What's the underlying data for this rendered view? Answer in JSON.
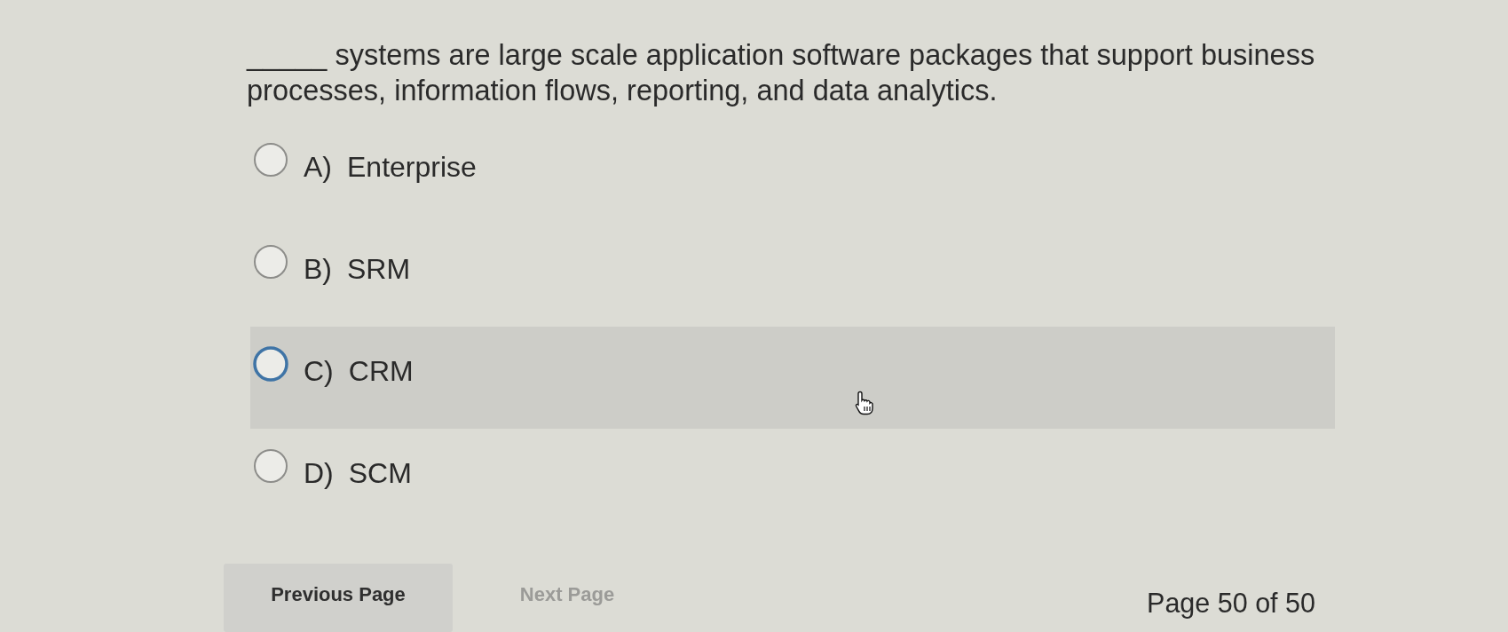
{
  "question": {
    "text": "_____ systems are large scale application software packages that support business processes, information flows, reporting, and data analytics."
  },
  "options": [
    {
      "letter": "A)",
      "text": "Enterprise",
      "selected": false,
      "hovered": false
    },
    {
      "letter": "B)",
      "text": "SRM",
      "selected": false,
      "hovered": false
    },
    {
      "letter": "C)",
      "text": "CRM",
      "selected": false,
      "hovered": true
    },
    {
      "letter": "D)",
      "text": "SCM",
      "selected": false,
      "hovered": false
    }
  ],
  "navigation": {
    "buttons": [
      {
        "label": "Previous Page",
        "disabled": false
      },
      {
        "label": "Next Page",
        "disabled": true
      }
    ],
    "page_indicator": "Page 50 of 50"
  }
}
